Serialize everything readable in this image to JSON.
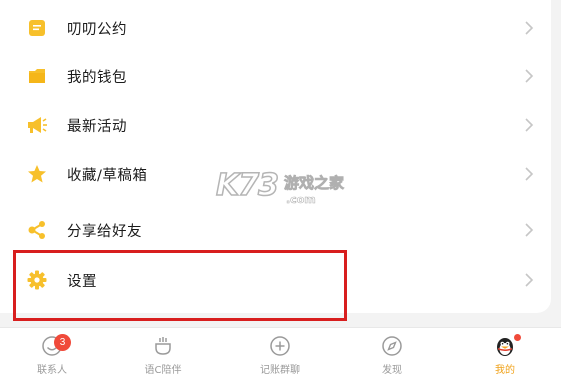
{
  "menu": {
    "items": [
      {
        "label": "叨叨公约",
        "icon": "notepad-icon"
      },
      {
        "label": "我的钱包",
        "icon": "wallet-icon"
      },
      {
        "label": "最新活动",
        "icon": "megaphone-icon"
      },
      {
        "label": "收藏/草稿箱",
        "icon": "star-icon"
      },
      {
        "label": "分享给好友",
        "icon": "share-icon"
      },
      {
        "label": "设置",
        "icon": "gear-icon"
      }
    ]
  },
  "watermark": {
    "logo": "K73",
    "name": "游戏之家",
    "url": ".com"
  },
  "tabbar": {
    "tabs": [
      {
        "label": "联系人",
        "icon": "contacts-icon",
        "badge": "3"
      },
      {
        "label": "语C陪伴",
        "icon": "companion-icon"
      },
      {
        "label": "记账群聊",
        "icon": "group-chat-icon"
      },
      {
        "label": "发现",
        "icon": "compass-icon"
      },
      {
        "label": "我的",
        "icon": "penguin-avatar-icon",
        "active": true,
        "dot": true
      }
    ]
  },
  "colors": {
    "accent": "#f7c02b",
    "active_tab": "#f0a21a",
    "highlight": "#d81e1e",
    "badge": "#f04a3a"
  }
}
